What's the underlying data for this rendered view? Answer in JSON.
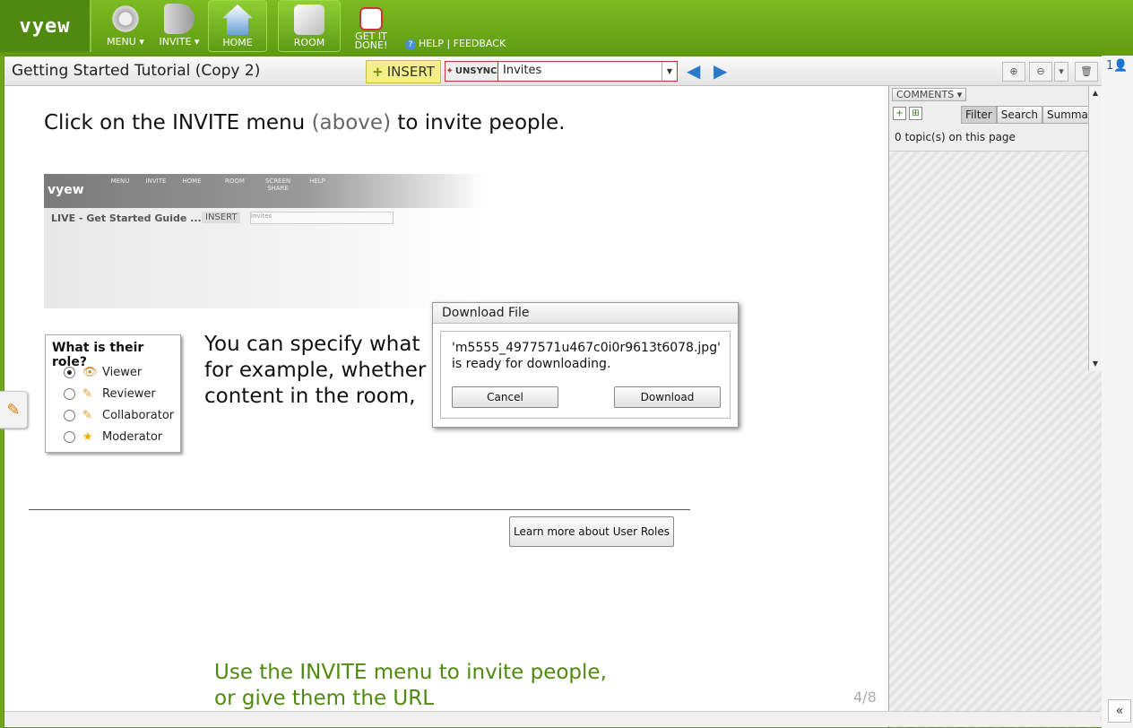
{
  "nav": {
    "logo": "vyew",
    "menu": "MENU",
    "invite": "INVITE",
    "home": "HOME",
    "room": "ROOM",
    "getitdone": "GET IT DONE!",
    "help": "HELP | FEEDBACK"
  },
  "toolbar": {
    "title": "Getting Started Tutorial (Copy 2)",
    "insert": "INSERT",
    "unsync": "UNSYNC",
    "page_select": "Invites"
  },
  "slide": {
    "heading_a": "Click on the INVITE menu",
    "heading_b": "(above)",
    "heading_c": "to invite people.",
    "shot_title": "LIVE - Get Started Guide ...",
    "shot_insert": "INSERT",
    "shot_sync": "Invites",
    "shot_menu": "MENU",
    "shot_invite": "INVITE",
    "shot_home": "HOME",
    "shot_room": "ROOM",
    "shot_screenshare": "SCREEN SHARE",
    "shot_help": "HELP",
    "role_title": "What is their role?",
    "roles": [
      "Viewer",
      "Reviewer",
      "Collaborator",
      "Moderator"
    ],
    "body_line1": "You can specify what",
    "body_line2": "for example, whether",
    "body_line3": "content in the room,",
    "learn_more": "Learn more about User Roles",
    "green_line1": "Use the INVITE menu to invite people,",
    "green_line2": "or give them the URL",
    "page_number": "4/8"
  },
  "dialog": {
    "title": "Download File",
    "message": "'m5555_4977571u467c0i0r9613t6078.jpg' is ready for downloading.",
    "cancel": "Cancel",
    "download": "Download"
  },
  "comments": {
    "header": "COMMENTS",
    "tabs": [
      "Filter",
      "Search",
      "Summary"
    ],
    "meta": "0 topic(s) on this page"
  },
  "people": {
    "count": "1"
  }
}
